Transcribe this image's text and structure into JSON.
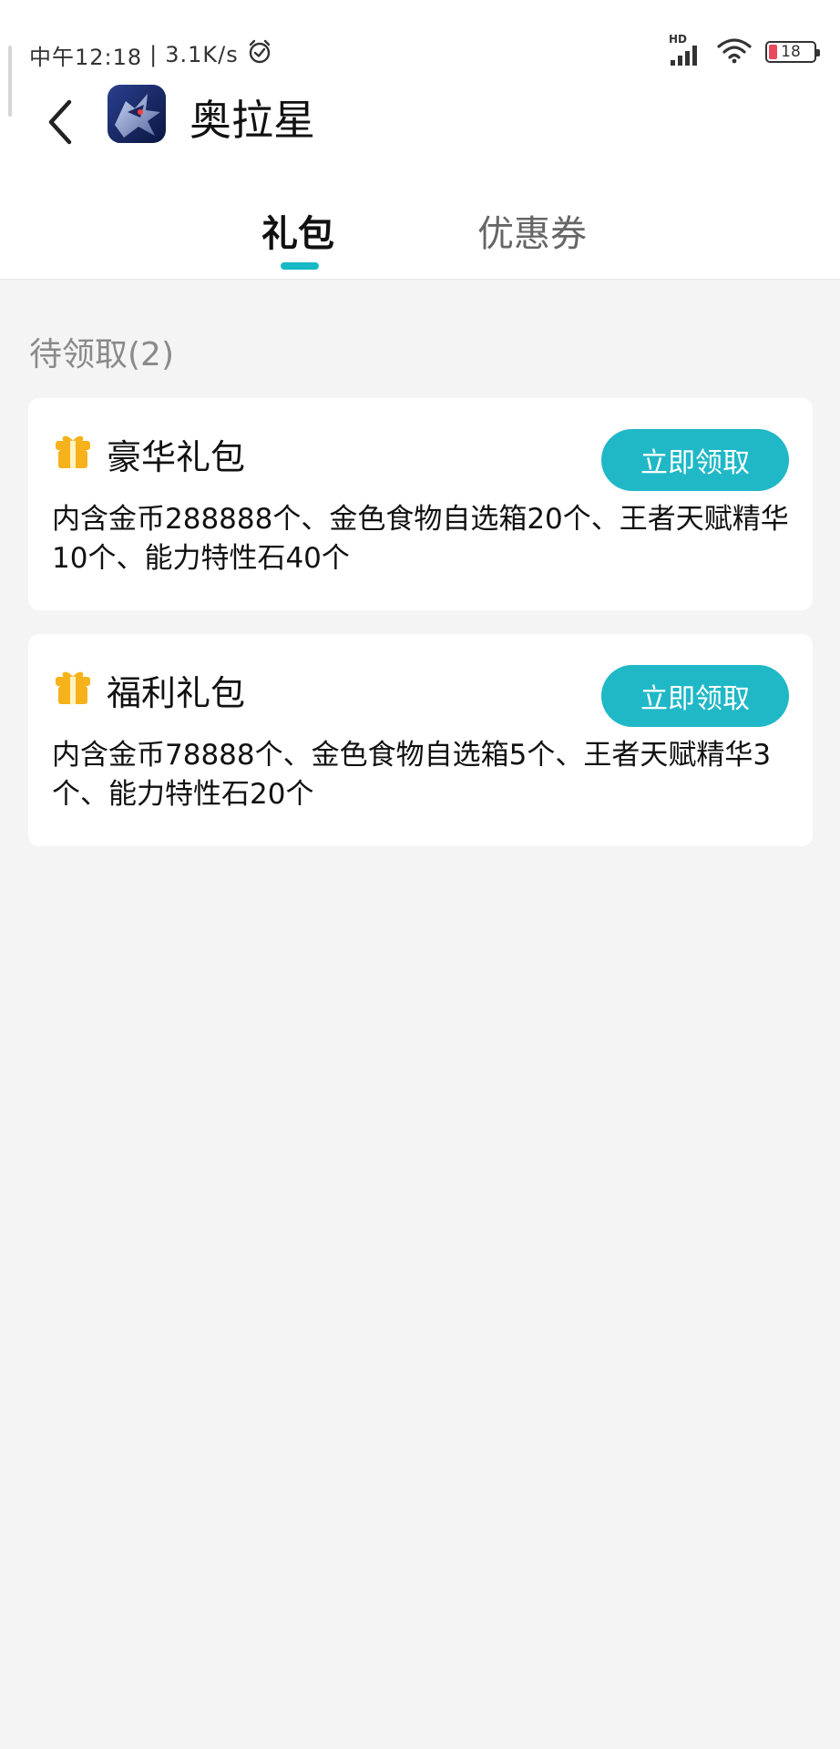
{
  "status_bar": {
    "time": "中午12:18",
    "speed": "3.1K/s",
    "network_label": "HD",
    "battery": "18"
  },
  "header": {
    "title": "奥拉星",
    "app_icon": "game-icon"
  },
  "tabs": [
    {
      "label": "礼包",
      "active": true
    },
    {
      "label": "优惠券",
      "active": false
    }
  ],
  "section": {
    "title": "待领取(2)"
  },
  "gifts": [
    {
      "title": "豪华礼包",
      "button": "立即领取",
      "description": "内含金币288888个、金色食物自选箱20个、王者天赋精华10个、能力特性石40个"
    },
    {
      "title": "福利礼包",
      "button": "立即领取",
      "description": "内含金币78888个、金色食物自选箱5个、王者天赋精华3个、能力特性石20个"
    }
  ],
  "colors": {
    "accent": "#20b8c7",
    "gift_icon": "#f6b21b",
    "background": "#f4f4f4"
  }
}
